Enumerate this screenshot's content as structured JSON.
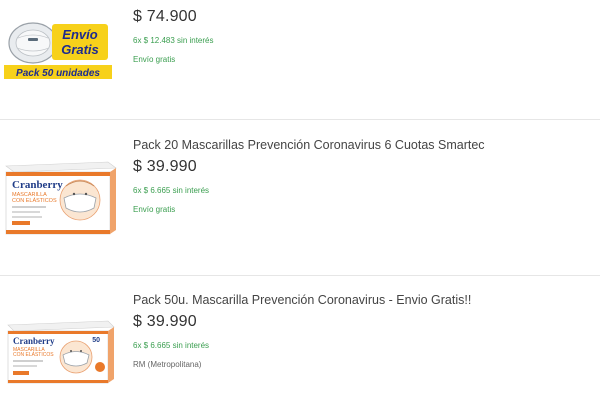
{
  "listing": {
    "items": [
      {
        "title": "",
        "price": "$ 74.900",
        "installments": "6x $ 12.483 sin interés",
        "shipping": "Envío gratis",
        "image": {
          "badge_line1": "Envío",
          "badge_line2": "Gratis",
          "caption": "Pack 50 unidades",
          "icon": "face-mask-icon"
        }
      },
      {
        "title": "Pack 20 Mascarillas Prevención Coronavirus 6 Cuotas Smartec",
        "price": "$ 39.990",
        "installments": "6x $ 6.665 sin interés",
        "shipping": "Envío gratis",
        "image": {
          "brand": "Cranberry",
          "product_line1": "MASCARILLA",
          "product_line2": "CON ELÁSTICOS",
          "icon": "mask-box-icon"
        }
      },
      {
        "title": "Pack 50u. Mascarilla Prevención Coronavirus - Envio Gratis!!",
        "price": "$ 39.990",
        "installments": "6x $ 6.665 sin interés",
        "location": "RM (Metropolitana)",
        "image": {
          "brand": "Cranberry",
          "product_line1": "MASCARILLA",
          "product_line2": "CON ELÁSTICOS",
          "count": "50",
          "icon": "mask-box-icon"
        }
      }
    ]
  },
  "colors": {
    "accent_green": "#3a9e4f",
    "badge_yellow": "#f7d11a",
    "box_orange": "#e9792a"
  }
}
